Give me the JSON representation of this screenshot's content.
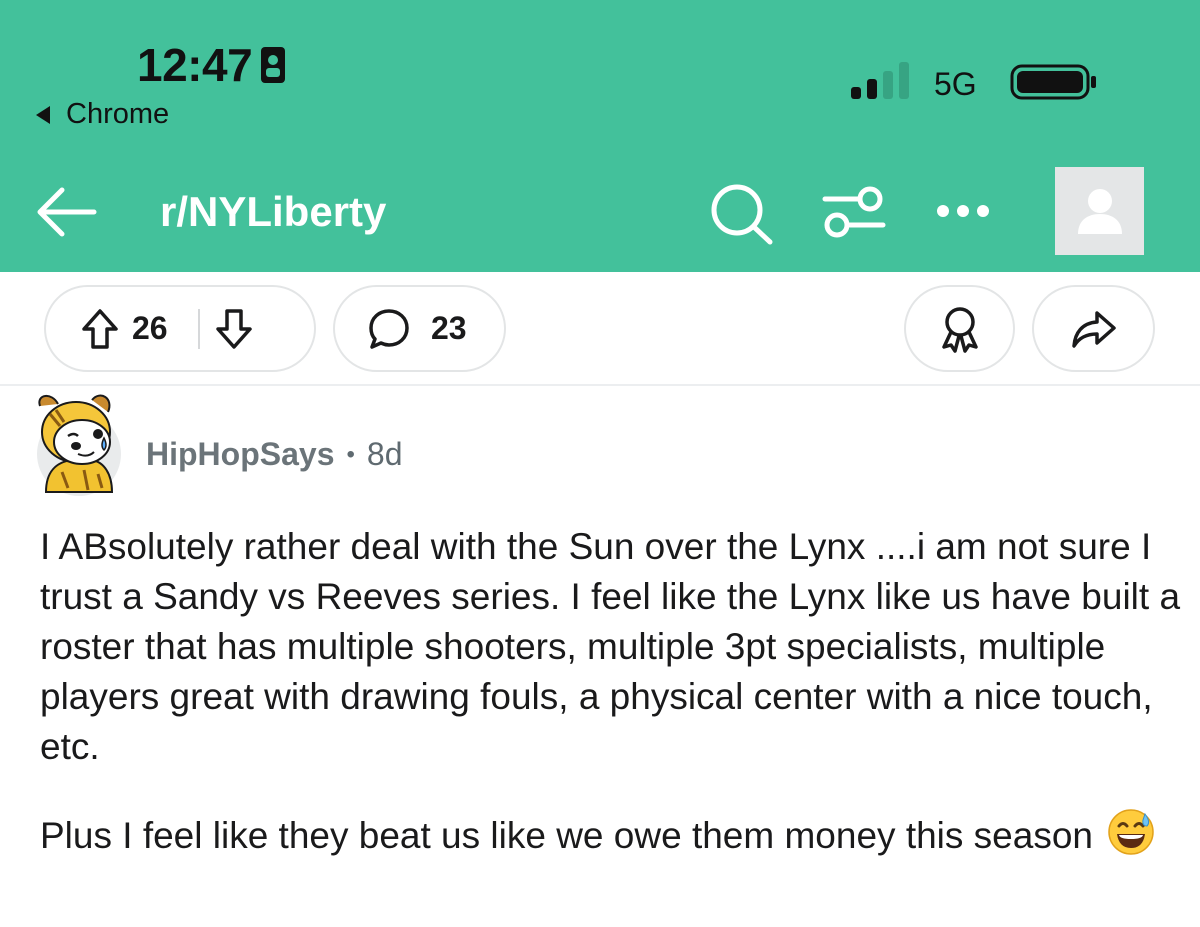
{
  "status_bar": {
    "time": "12:47",
    "back_app": "Chrome",
    "network": "5G"
  },
  "nav": {
    "subreddit": "r/NYLiberty",
    "icons": [
      "back-arrow-icon",
      "search-icon",
      "filter-icon",
      "more-icon",
      "user-avatar-icon"
    ]
  },
  "actions": {
    "upvotes": "26",
    "comments": "23",
    "icons": [
      "upvote-icon",
      "downvote-icon",
      "comment-icon",
      "award-icon",
      "share-icon"
    ]
  },
  "comment": {
    "username": "HipHopSays",
    "separator": "•",
    "age": "8d",
    "paragraphs": [
      "I ABsolutely rather deal with the Sun over the Lynx ....i am not sure I trust a Sandy vs Reeves series. I feel like the Lynx like us have built a roster that has multiple shooters, multiple 3pt specialists, multiple players great with drawing fouls, a physical center with a nice touch, etc.",
      "Plus I feel like they beat us like we owe them money this season"
    ]
  },
  "colors": {
    "header_bg": "#43c19b",
    "text": "#1a1a1b",
    "meta_text": "#5f6a70"
  }
}
